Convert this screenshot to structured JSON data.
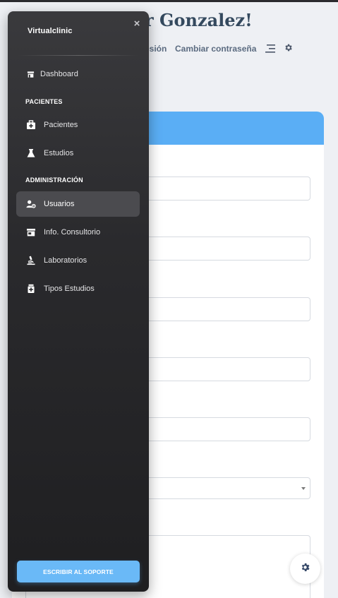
{
  "page": {
    "title_fragment": "r Gonzalez!",
    "nav": {
      "logout_fragment": "esión",
      "change_password": "Cambiar contraseña",
      "menu_icon": "menu-lines-icon",
      "settings_icon": "gear-icon"
    }
  },
  "sidebar": {
    "brand": "Virtualclinic",
    "close_icon": "close-icon",
    "close_glyph": "×",
    "dashboard": {
      "label": "Dashboard",
      "icon": "store-icon"
    },
    "sections": [
      {
        "heading": "PACIENTES",
        "items": [
          {
            "label": "Pacientes",
            "icon": "medkit-icon"
          },
          {
            "label": "Estudios",
            "icon": "flask-icon"
          }
        ]
      },
      {
        "heading": "ADMINISTRACIÓN",
        "items": [
          {
            "label": "Usuarios",
            "icon": "user-cog-icon",
            "active": true
          },
          {
            "label": "Info. Consultorio",
            "icon": "storefront-icon"
          },
          {
            "label": "Laboratorios",
            "icon": "microscope-icon"
          },
          {
            "label": "Tipos Estudios",
            "icon": "medical-box-icon"
          }
        ]
      }
    ],
    "support_button": "ESCRIBIR AL SOPORTE"
  },
  "colors": {
    "accent": "#5aaef5",
    "sidebar_bg": "#2a2a2d",
    "active_item": "#4b4b4f",
    "title": "#34495e",
    "page_bg": "#eef0f4"
  }
}
